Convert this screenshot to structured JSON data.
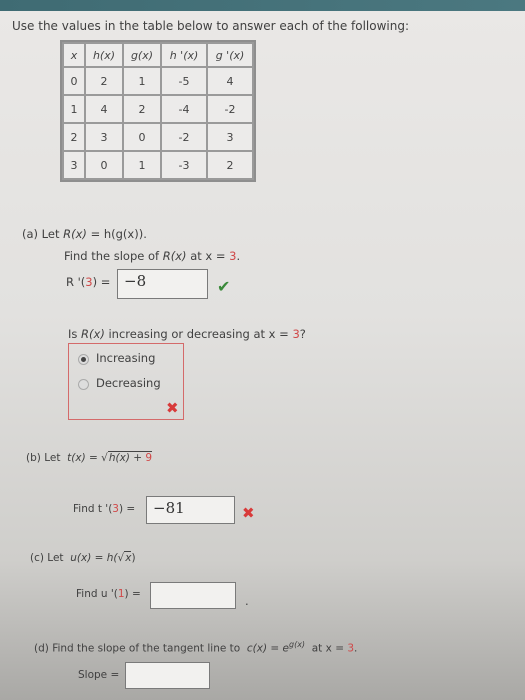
{
  "header": {
    "title": "Use the values in the table below to answer each of the following:"
  },
  "table": {
    "columns": [
      "x",
      "h(x)",
      "g(x)",
      "h '(x)",
      "g '(x)"
    ],
    "rows": [
      [
        "0",
        "2",
        "1",
        "-5",
        "4"
      ],
      [
        "1",
        "4",
        "2",
        "-4",
        "-2"
      ],
      [
        "2",
        "3",
        "0",
        "-2",
        "3"
      ],
      [
        "3",
        "0",
        "1",
        "-3",
        "2"
      ]
    ]
  },
  "part_a": {
    "label": "(a) Let",
    "func": "R(x)",
    "eq": "= h(g(x)).",
    "find_text": "Find the slope of",
    "find_func": "R(x)",
    "find_at": "at x =",
    "x_value": "3",
    "answer_label_pre": "R '(",
    "answer_label_post": ") =",
    "answer_value": "−8",
    "answer_status": "correct",
    "question2_pre": "Is",
    "question2_func": "R(x)",
    "question2_mid": "increasing or decreasing at x =",
    "question2_end": "?",
    "options": [
      {
        "label": "Increasing",
        "selected": true
      },
      {
        "label": "Decreasing",
        "selected": false
      }
    ],
    "choice_status": "incorrect"
  },
  "part_b": {
    "label": "(b) Let",
    "func": "t(x) =",
    "radicand": "h(x) +",
    "const": "9",
    "find_pre": "Find t '(",
    "x_value": "3",
    "find_post": ") =",
    "answer_value": "−81",
    "answer_status": "incorrect"
  },
  "part_c": {
    "label": "(c) Let",
    "func": "u(x) = h(",
    "radicand": "x",
    "close": ")",
    "find_pre": "Find u '(",
    "x_value": "1",
    "find_post": ") =",
    "answer_value": "",
    "trailing": "."
  },
  "part_d": {
    "label": "(d) Find the slope of the tangent line to",
    "func": "c(x) = e",
    "exponent": "g(x)",
    "at": "at x =",
    "x_value": "3",
    "period": ".",
    "slope_label": "Slope =",
    "answer_value": ""
  },
  "colors": {
    "accent_red": "#d04848",
    "check_green": "#3a8a3a",
    "cross_red": "#d83a3a"
  }
}
